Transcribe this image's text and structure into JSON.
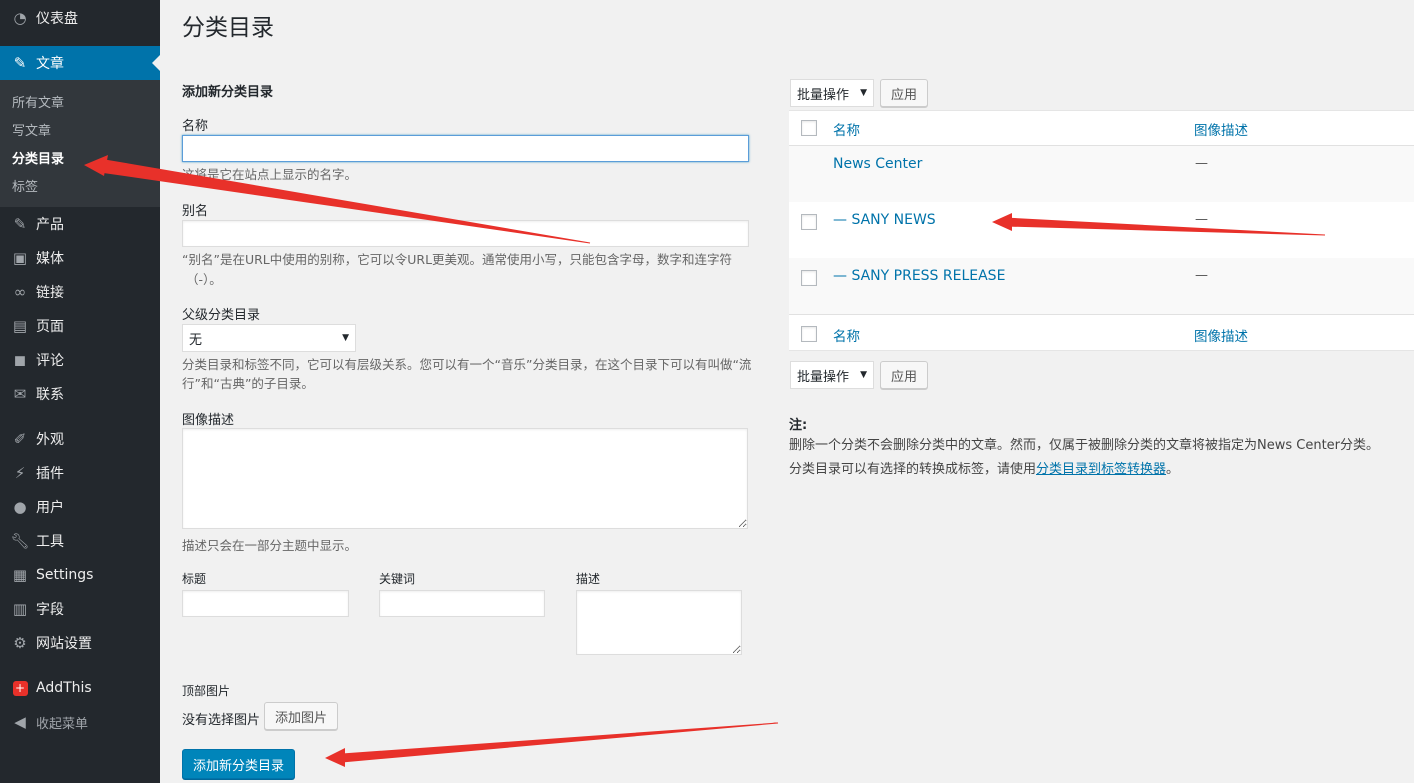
{
  "sidebar": {
    "items": [
      {
        "label": "仪表盘",
        "icon": "dashboard-icon"
      },
      {
        "label": "文章",
        "icon": "pin-icon"
      },
      {
        "label": "产品",
        "icon": "pin-icon"
      },
      {
        "label": "媒体",
        "icon": "media-icon"
      },
      {
        "label": "链接",
        "icon": "link-icon"
      },
      {
        "label": "页面",
        "icon": "page-icon"
      },
      {
        "label": "评论",
        "icon": "comment-icon"
      },
      {
        "label": "联系",
        "icon": "mail-icon"
      },
      {
        "label": "外观",
        "icon": "brush-icon"
      },
      {
        "label": "插件",
        "icon": "plugin-icon"
      },
      {
        "label": "用户",
        "icon": "user-icon"
      },
      {
        "label": "工具",
        "icon": "wrench-icon"
      },
      {
        "label": "Settings",
        "icon": "settings-icon"
      },
      {
        "label": "字段",
        "icon": "fields-icon"
      },
      {
        "label": "网站设置",
        "icon": "gear-icon"
      },
      {
        "label": "AddThis",
        "icon": "addthis-icon"
      },
      {
        "label": "收起菜单",
        "icon": "collapse-icon"
      }
    ],
    "submenu": [
      "所有文章",
      "写文章",
      "分类目录",
      "标签"
    ]
  },
  "page": {
    "title": "分类目录"
  },
  "form": {
    "heading": "添加新分类目录",
    "name_label": "名称",
    "name_value": "",
    "name_help": "这将是它在站点上显示的名字。",
    "slug_label": "别名",
    "slug_help_1": "“别名”是在URL中使用的别称，它可以令URL更美观。通常使用小写，只能包含字母，数字和连字符",
    "slug_help_2": "（-）。",
    "parent_label": "父级分类目录",
    "parent_value": "无",
    "parent_help_1": "分类目录和标签不同，它可以有层级关系。您可以有一个“音乐”分类目录，在这个目录下可以有叫做“流",
    "parent_help_2": "行”和“古典”的子目录。",
    "image_desc_label": "图像描述",
    "image_desc_help": "描述只会在一部分主题中显示。",
    "title_label": "标题",
    "keywords_label": "关键词",
    "desc_label": "描述",
    "top_image_label": "顶部图片",
    "no_image_text": "没有选择图片",
    "add_image_button": "添加图片",
    "submit_button": "添加新分类目录"
  },
  "table": {
    "bulk_label": "批量操作",
    "apply_label": "应用",
    "col_name": "名称",
    "col_image_desc": "图像描述",
    "rows": [
      {
        "name": "News Center",
        "image_desc": "—",
        "checkbox": false
      },
      {
        "name": "— SANY NEWS",
        "image_desc": "—",
        "checkbox": true
      },
      {
        "name": "— SANY PRESS RELEASE",
        "image_desc": "—",
        "checkbox": true
      }
    ]
  },
  "note": {
    "title": "注:",
    "line1": "删除一个分类不会删除分类中的文章。然而，仅属于被删除分类的文章将被指定为News Center分类。",
    "line2_prefix": "分类目录可以有选择的转换成标签，请使用",
    "line2_link": "分类目录到标签转换器",
    "line2_suffix": "。"
  },
  "colors": {
    "accent": "#0073aa",
    "sidebar": "#23282d",
    "arrow": "#e8312a"
  }
}
